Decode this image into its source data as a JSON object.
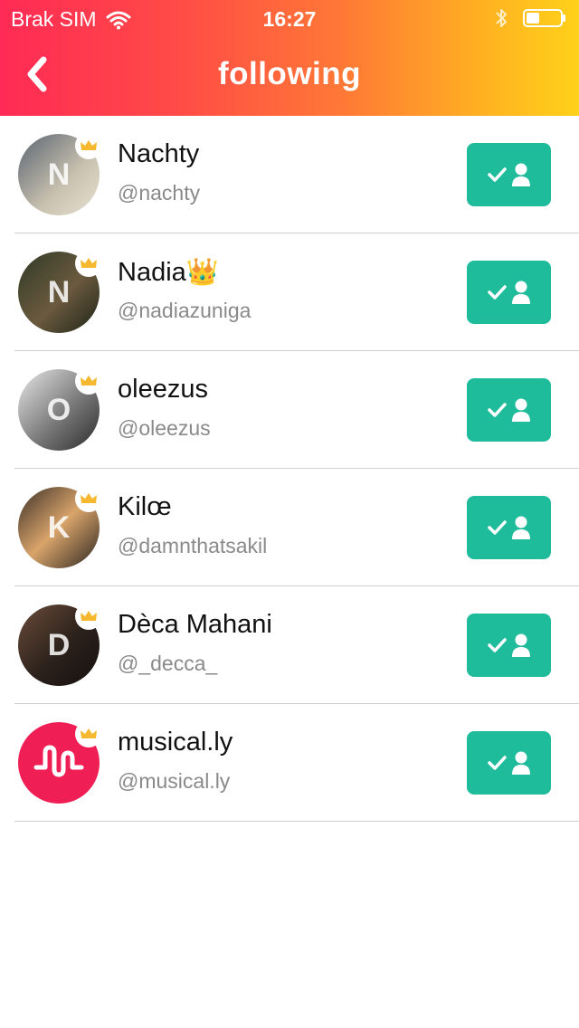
{
  "status_bar": {
    "carrier": "Brak SIM",
    "time": "16:27"
  },
  "nav": {
    "title": "following",
    "back_icon": "chevron-left-icon"
  },
  "colors": {
    "header_gradient": [
      "#ff2a55",
      "#ff7a35",
      "#ffd11a"
    ],
    "follow_button": "#1fbc9c",
    "crown": "#f5b82e",
    "divider": "#cfcfcf"
  },
  "users": [
    {
      "display_name": "Nachty",
      "username": "@nachty",
      "avatar_initial": "N",
      "avatar_bg": "linear-gradient(135deg,#5a6470,#c9c2b0 60%,#e7e1d2)",
      "status": "following"
    },
    {
      "display_name": "Nadia👑",
      "username": "@nadiazuniga",
      "avatar_initial": "N",
      "avatar_bg": "linear-gradient(135deg,#2f3a26,#6b5a3f 55%,#1d2316)",
      "status": "following"
    },
    {
      "display_name": "oleezus",
      "username": "@oleezus",
      "avatar_initial": "O",
      "avatar_bg": "linear-gradient(135deg,#e8e8e8,#7a7a7a 55%,#2a2a2a)",
      "status": "following"
    },
    {
      "display_name": "Kilœ",
      "username": "@damnthatsakil",
      "avatar_initial": "K",
      "avatar_bg": "linear-gradient(135deg,#3a2f28,#d9a46a 50%,#2a2420)",
      "status": "following"
    },
    {
      "display_name": "Dèca Mahani",
      "username": "@_decca_",
      "avatar_initial": "D",
      "avatar_bg": "linear-gradient(135deg,#6b4c3a,#2b211b 55%,#141010)",
      "status": "following"
    },
    {
      "display_name": "musical.ly",
      "username": "@musical.ly",
      "avatar_initial": "",
      "avatar_bg": "#ef1f55",
      "status": "following"
    }
  ]
}
